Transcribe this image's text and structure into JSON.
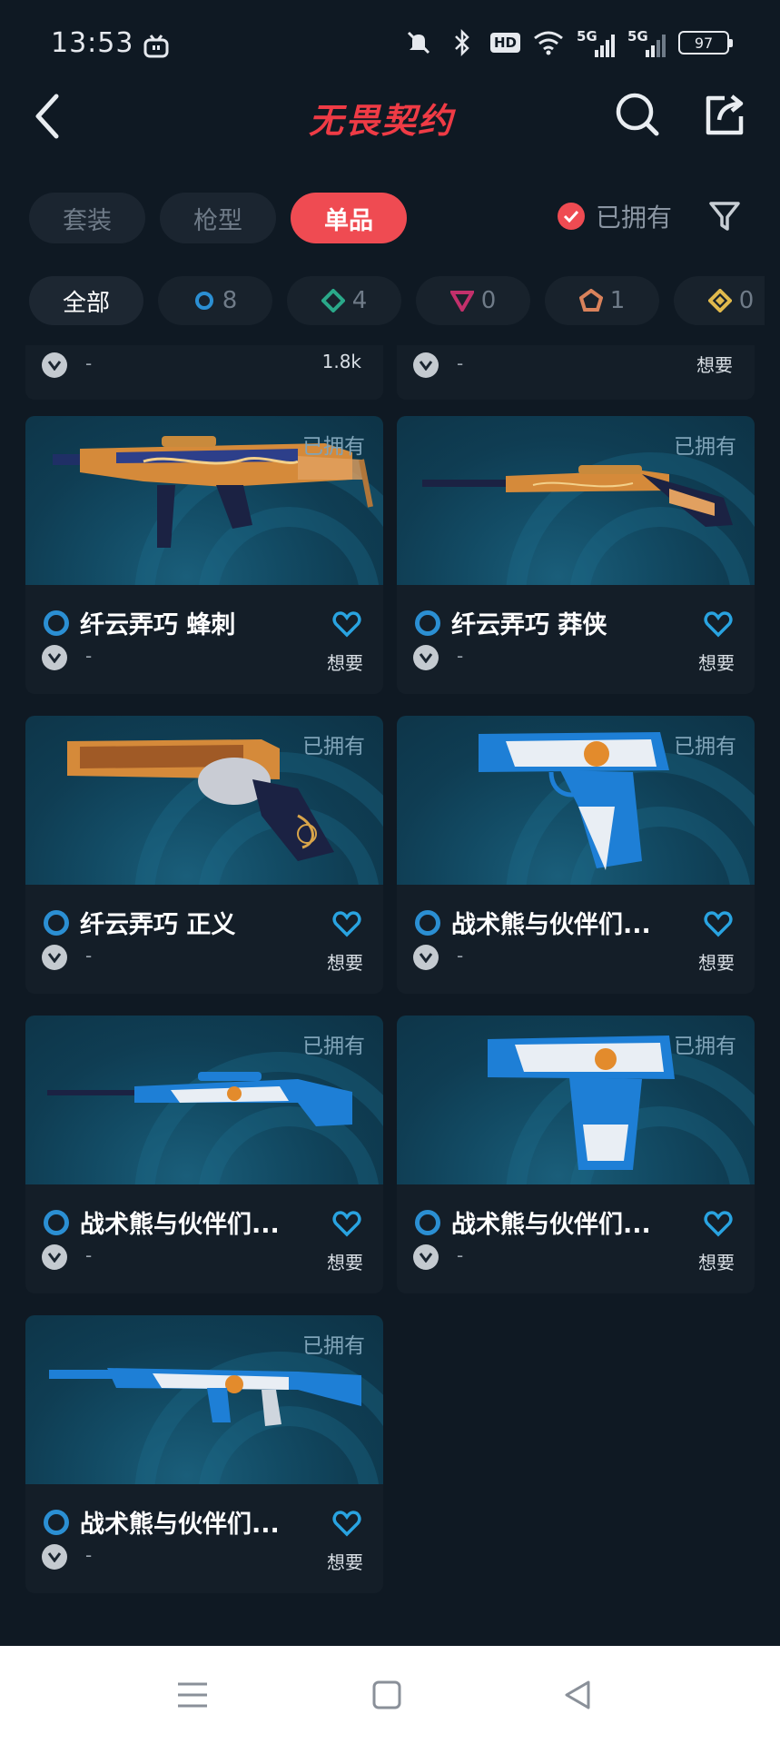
{
  "status_bar": {
    "time": "13:53",
    "hd": "HD",
    "network1": "5G",
    "network2": "5G",
    "battery": "97"
  },
  "header": {
    "title": "无畏契约",
    "back_icon": "chevron-left-icon",
    "search_icon": "search-icon",
    "share_icon": "share-icon"
  },
  "tabs": [
    {
      "label": "套装",
      "active": false
    },
    {
      "label": "枪型",
      "active": false
    },
    {
      "label": "单品",
      "active": true
    }
  ],
  "owned_filter": {
    "label": "已拥有",
    "checked": true
  },
  "chips": [
    {
      "label": "全部",
      "count": ""
    },
    {
      "label": "",
      "count": "8",
      "color": "#2b8fd3"
    },
    {
      "label": "",
      "count": "4",
      "color": "#2aa889"
    },
    {
      "label": "",
      "count": "0",
      "color": "#c2306b"
    },
    {
      "label": "",
      "count": "1",
      "color": "#d9825b"
    },
    {
      "label": "",
      "count": "0",
      "color": "#e0b94c"
    }
  ],
  "partial_row": [
    {
      "dash": "-",
      "meta": "1.8k"
    },
    {
      "dash": "-",
      "meta": "想要"
    }
  ],
  "cards": [
    {
      "name": "纤云弄巧 蜂刺",
      "owned": "已拥有",
      "want": "想要",
      "dash": "-"
    },
    {
      "name": "纤云弄巧 莽侠",
      "owned": "已拥有",
      "want": "想要",
      "dash": "-"
    },
    {
      "name": "纤云弄巧 正义",
      "owned": "已拥有",
      "want": "想要",
      "dash": "-"
    },
    {
      "name": "战术熊与伙伴们...",
      "owned": "已拥有",
      "want": "想要",
      "dash": "-"
    },
    {
      "name": "战术熊与伙伴们...",
      "owned": "已拥有",
      "want": "想要",
      "dash": "-"
    },
    {
      "name": "战术熊与伙伴们...",
      "owned": "已拥有",
      "want": "想要",
      "dash": "-"
    },
    {
      "name": "战术熊与伙伴们...",
      "owned": "已拥有",
      "want": "想要",
      "dash": "-"
    }
  ],
  "colors": {
    "accent": "#ef4b52",
    "background": "#0f1923",
    "tier_blue": "#2b8fd3"
  }
}
